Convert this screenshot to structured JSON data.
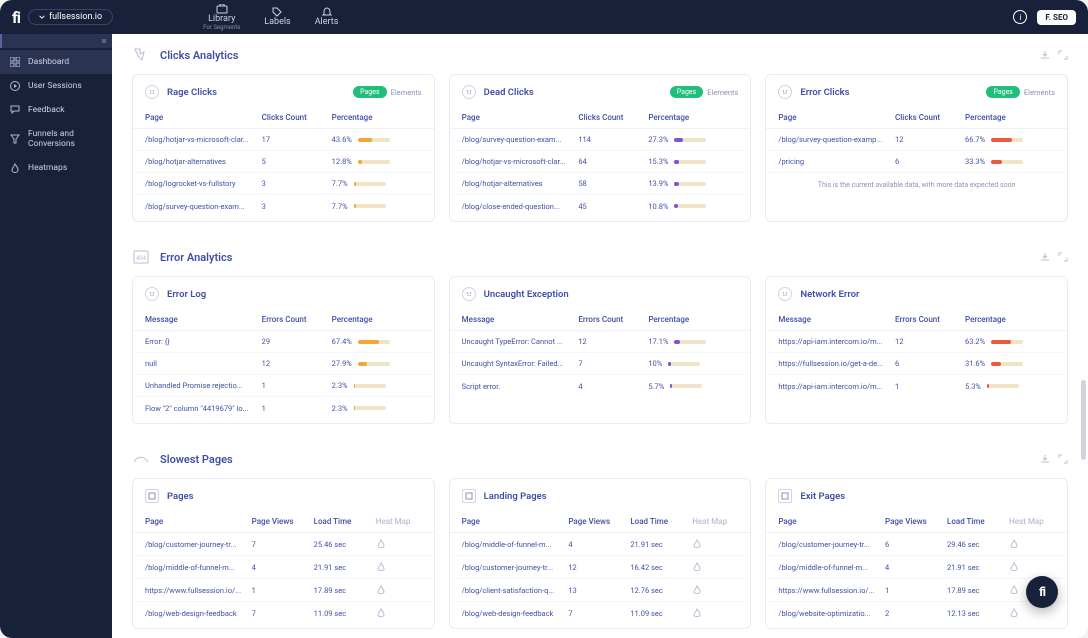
{
  "topbar": {
    "logo": "fi",
    "site": "fullsession.io",
    "nav": {
      "library": "Library",
      "library_sub": "For Segments",
      "labels": "Labels",
      "alerts": "Alerts"
    },
    "user": "F. SEO"
  },
  "sidebar": {
    "items": [
      {
        "label": "Dashboard"
      },
      {
        "label": "User Sessions"
      },
      {
        "label": "Feedback"
      },
      {
        "label": "Funnels and Conversions"
      },
      {
        "label": "Heatmaps"
      }
    ]
  },
  "sections": {
    "clicks": {
      "title": "Clicks Analytics",
      "cards": {
        "rage": {
          "title": "Rage Clicks",
          "badge_primary": "Pages",
          "badge_secondary": "Elements",
          "columns": [
            "Page",
            "Clicks Count",
            "Percentage"
          ],
          "rows": [
            {
              "page": "/blog/hotjar-vs-microsoft-clar...",
              "count": "17",
              "pct": "43.6%",
              "fill": 43.6,
              "color": "#f2a63b"
            },
            {
              "page": "/blog/hotjar-alternatives",
              "count": "5",
              "pct": "12.8%",
              "fill": 12.8,
              "color": "#f2a63b"
            },
            {
              "page": "/blog/logrocket-vs-fullstory",
              "count": "3",
              "pct": "7.7%",
              "fill": 7.7,
              "color": "#f2a63b"
            },
            {
              "page": "/blog/survey-question-exam...",
              "count": "3",
              "pct": "7.7%",
              "fill": 7.7,
              "color": "#f2a63b"
            }
          ]
        },
        "dead": {
          "title": "Dead Clicks",
          "badge_primary": "Pages",
          "badge_secondary": "Elements",
          "columns": [
            "Page",
            "Clicks Count",
            "Percentage"
          ],
          "rows": [
            {
              "page": "/blog/survey-question-exam...",
              "count": "114",
              "pct": "27.3%",
              "fill": 27.3,
              "color": "#7a55d6"
            },
            {
              "page": "/blog/hotjar-vs-microsoft-clar...",
              "count": "64",
              "pct": "15.3%",
              "fill": 15.3,
              "color": "#7a55d6"
            },
            {
              "page": "/blog/hotjar-alternatives",
              "count": "58",
              "pct": "13.9%",
              "fill": 13.9,
              "color": "#7a55d6"
            },
            {
              "page": "/blog/close-ended-question...",
              "count": "45",
              "pct": "10.8%",
              "fill": 10.8,
              "color": "#7a55d6"
            }
          ]
        },
        "error": {
          "title": "Error Clicks",
          "badge_primary": "Pages",
          "badge_secondary": "Elements",
          "columns": [
            "Page",
            "Clicks Count",
            "Percentage"
          ],
          "rows": [
            {
              "page": "/blog/survey-question-examp...",
              "count": "12",
              "pct": "66.7%",
              "fill": 66.7,
              "color": "#e85b3e"
            },
            {
              "page": "/pricing",
              "count": "6",
              "pct": "33.3%",
              "fill": 33.3,
              "color": "#e85b3e"
            }
          ],
          "note": "This is the current available data, with more data expected soon"
        }
      }
    },
    "errors": {
      "title": "Error Analytics",
      "cards": {
        "log": {
          "title": "Error Log",
          "columns": [
            "Message",
            "Errors Count",
            "Percentage"
          ],
          "rows": [
            {
              "msg": "Error: {}",
              "count": "29",
              "pct": "67.4%",
              "fill": 67.4,
              "color": "#f2a63b"
            },
            {
              "msg": "null",
              "count": "12",
              "pct": "27.9%",
              "fill": 27.9,
              "color": "#f2a63b"
            },
            {
              "msg": "Unhandled Promise rejectio...",
              "count": "1",
              "pct": "2.3%",
              "fill": 2.3,
              "color": "#f2a63b"
            },
            {
              "msg": "Flow \"2\" column \"4419679\" lo...",
              "count": "1",
              "pct": "2.3%",
              "fill": 2.3,
              "color": "#f2a63b"
            }
          ]
        },
        "uncaught": {
          "title": "Uncaught Exception",
          "columns": [
            "Message",
            "Errors Count",
            "Percentage"
          ],
          "rows": [
            {
              "msg": "Uncaught TypeError: Cannot ...",
              "count": "12",
              "pct": "17.1%",
              "fill": 17.1,
              "color": "#7a55d6"
            },
            {
              "msg": "Uncaught SyntaxError: Failed...",
              "count": "7",
              "pct": "10%",
              "fill": 10,
              "color": "#7a55d6"
            },
            {
              "msg": "Script error.",
              "count": "4",
              "pct": "5.7%",
              "fill": 5.7,
              "color": "#7a55d6"
            }
          ]
        },
        "network": {
          "title": "Network Error",
          "columns": [
            "Message",
            "Errors Count",
            "Percentage"
          ],
          "rows": [
            {
              "msg": "https://api-iam.intercom.io/m...",
              "count": "12",
              "pct": "63.2%",
              "fill": 63.2,
              "color": "#e85b3e"
            },
            {
              "msg": "https://fullsession.io/get-a-de...",
              "count": "6",
              "pct": "31.6%",
              "fill": 31.6,
              "color": "#e85b3e"
            },
            {
              "msg": "https://api-iam.intercom.io/m...",
              "count": "1",
              "pct": "5.3%",
              "fill": 5.3,
              "color": "#e85b3e"
            }
          ]
        }
      }
    },
    "slowest": {
      "title": "Slowest Pages",
      "cards": {
        "pages": {
          "title": "Pages",
          "columns": [
            "Page",
            "Page Views",
            "Load Time",
            "Heat Map"
          ],
          "rows": [
            {
              "page": "/blog/customer-journey-tr...",
              "views": "7",
              "time": "25.46 sec"
            },
            {
              "page": "/blog/middle-of-funnel-m...",
              "views": "4",
              "time": "21.91 sec"
            },
            {
              "page": "https://www.fullsession.io/...",
              "views": "1",
              "time": "17.89 sec"
            },
            {
              "page": "/blog/web-design-feedback",
              "views": "7",
              "time": "11.09 sec"
            }
          ]
        },
        "landing": {
          "title": "Landing Pages",
          "columns": [
            "Page",
            "Page Views",
            "Load Time",
            "Heat Map"
          ],
          "rows": [
            {
              "page": "/blog/middle-of-funnel-m...",
              "views": "4",
              "time": "21.91 sec"
            },
            {
              "page": "/blog/customer-journey-tr...",
              "views": "12",
              "time": "16.42 sec"
            },
            {
              "page": "/blog/client-satisfaction-q...",
              "views": "13",
              "time": "12.76 sec"
            },
            {
              "page": "/blog/web-design-feedback",
              "views": "7",
              "time": "11.09 sec"
            }
          ]
        },
        "exit": {
          "title": "Exit Pages",
          "columns": [
            "Page",
            "Page Views",
            "Load Time",
            "Heat Map"
          ],
          "rows": [
            {
              "page": "/blog/customer-journey-tr...",
              "views": "6",
              "time": "29.46 sec"
            },
            {
              "page": "/blog/middle-of-funnel-m...",
              "views": "4",
              "time": "21.91 sec"
            },
            {
              "page": "https://www.fullsession.io/...",
              "views": "1",
              "time": "17.89 sec"
            },
            {
              "page": "/blog/website-optimizatio...",
              "views": "2",
              "time": "12.13 sec"
            }
          ]
        }
      }
    }
  }
}
